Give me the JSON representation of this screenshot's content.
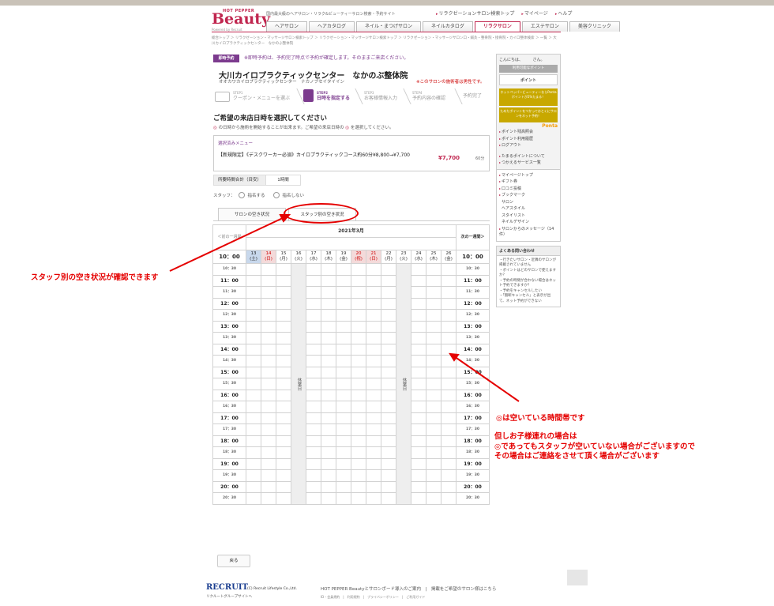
{
  "header": {
    "logo_sub": "HOT PEPPER",
    "logo_main": "Beauty",
    "logo_powered": "Powered by Recruit",
    "tagline": "国内最大級のヘアサロン・リラク&ビューティーサロン検索・予約サイト",
    "top_links": [
      "リラクゼーションサロン検索トップ",
      "マイページ",
      "ヘルプ"
    ],
    "nav": [
      "ヘアサロン",
      "ヘアカタログ",
      "ネイル・まつげサロン",
      "ネイルカタログ",
      "リラクサロン",
      "エステサロン",
      "美容クリニック"
    ],
    "nav_active": 4
  },
  "breadcrumb": "総合トップ ＞ リラクゼーション・マッサージサロン検索トップ ＞ リラクゼーション・マッサージサロン検索トップ ＞ リラクゼーション・マッサージサロン口・鍼灸・整骨院・接骨院・カイロ整体検索 ＞ 一覧 ＞ 大川カイロプラクティックセンター　なかのぶ整体院",
  "notice": {
    "badge": "即時予約",
    "text": "※即時予約は、予約完了時点で予約が確定します。そのままご来店ください。"
  },
  "salon": {
    "name": "大川カイロプラクティックセンター　なかのぶ整体院",
    "kana": "オオカワカイロプラクティックセンター　ナカノブセイタイイン",
    "note": "※このサロンの施術者は男性です。"
  },
  "steps": [
    {
      "num": "STEP1",
      "label": "クーポン・メニューを選ぶ"
    },
    {
      "num": "STEP2",
      "label": "日時を指定する"
    },
    {
      "num": "STEP3",
      "label": "お客様情報入力"
    },
    {
      "num": "STEP4",
      "label": "予約内容の確認"
    },
    {
      "num": "",
      "label": "予約完了"
    }
  ],
  "section_title": "ご希望の来店日時を選択してください",
  "section_sub_a": "の日時から施術を開始することが出来ます。ご希望の来店日時の",
  "section_sub_b": "を選択してください。",
  "section_sub_mark": "◎",
  "menu": {
    "label": "選択済みメニュー",
    "name": "【新規限定】《デスクワーカー必須》カイロプラクティックコース約60分¥8,800→¥7,700",
    "price": "¥7,700",
    "minutes": "60分"
  },
  "duration": {
    "label": "所要時間合計（目安）",
    "value": "1時間"
  },
  "staff": {
    "label": "スタッフ：",
    "opt1": "指名する",
    "opt2": "指名しない"
  },
  "tabs": [
    "サロンの空き状況",
    "スタッフ別の空き状況"
  ],
  "grid": {
    "month": "2021年3月",
    "prev": "＜前の一週間",
    "next": "次の一週間＞",
    "days": [
      {
        "d": "13",
        "w": "(土)",
        "c": "cy"
      },
      {
        "d": "14",
        "w": "(日)",
        "c": "cy sun"
      },
      {
        "d": "15",
        "w": "(月)",
        "c": ""
      },
      {
        "d": "16",
        "w": "(火)",
        "c": ""
      },
      {
        "d": "17",
        "w": "(水)",
        "c": ""
      },
      {
        "d": "18",
        "w": "(木)",
        "c": ""
      },
      {
        "d": "19",
        "w": "(金)",
        "c": ""
      },
      {
        "d": "20",
        "w": "(祝)",
        "c": "sun"
      },
      {
        "d": "21",
        "w": "(日)",
        "c": "sun"
      },
      {
        "d": "22",
        "w": "(月)",
        "c": ""
      },
      {
        "d": "23",
        "w": "(火)",
        "c": ""
      },
      {
        "d": "24",
        "w": "(水)",
        "c": ""
      },
      {
        "d": "25",
        "w": "(木)",
        "c": ""
      },
      {
        "d": "26",
        "w": "(金)",
        "c": ""
      }
    ],
    "time_header": "10：00",
    "closed_text": "休業日",
    "times": [
      "10：30",
      "11：00",
      "11：30",
      "12：00",
      "12：30",
      "13：00",
      "13：30",
      "14：00",
      "14：30",
      "15：00",
      "15：30",
      "16：00",
      "16：30",
      "17：00",
      "17：30",
      "18：00",
      "18：30",
      "19：00",
      "19：30",
      "20：00",
      "20：30"
    ]
  },
  "back_button": "戻る",
  "sidebar": {
    "greeting": "こんにちは、　　　さん。",
    "points_label": "利用可能なポイント",
    "points_val": "ポイント",
    "promo1": "ホットペッパービューティーならPontaポイントが2%たまる！",
    "promo2": "ためたポイントをつかっておとくにサロンをネット予約！",
    "ponta": "Ponta",
    "links1": [
      "ポイント残高照会",
      "ポイント利用履歴",
      "ログアウト"
    ],
    "links2": [
      "たまるポイントについて",
      "つかえるサービス一覧"
    ],
    "links3": [
      "マイページトップ",
      "ギフト券",
      "口コミ投稿",
      "ブックマーク"
    ],
    "links3sub": [
      "サロン",
      "ヘアスタイル",
      "スタイリスト",
      "ネイルデザイン"
    ],
    "links4": [
      "サロンからのメッセージ（14件）"
    ],
    "faq_title": "よくある問い合わせ",
    "faq": [
      "行きたいサロン・近隣のサロンが掲載されていません",
      "ポイントはどのサロンで使えますか？",
      "予約の時間が合わない場合はネット予約できますか？",
      "予約をキャンセルしたい",
      "「無断キャンセル」と表示が出て、ネット予約ができない"
    ]
  },
  "annotations": {
    "a1": "スタッフ別の空き状況が確認できます",
    "a2": "◎は空いている時間帯です",
    "a3": [
      "但しお子様連れの場合は",
      "◎であってもスタッフが空いていない場合がございますので",
      "その場合はご連絡をさせて頂く場合がございます"
    ],
    "arrow_color": "#e50000"
  },
  "footer": {
    "recruit": "RECRUIT",
    "copyright": "(C) Recruit Lifestyle Co.,Ltd.",
    "group": "リクルートグループサイトへ",
    "links": "HOT PEPPER Beautyとサロンボード導入のご案内　|　掲載をご希望のサロン様はこちら",
    "links2": "ID・会員規約　|　利用規約　|　プライバシーポリシー　|　ご利用ガイド"
  },
  "colors": {
    "brand": "#c0264f",
    "accent": "#7c3b8e",
    "annotation": "#e50000"
  }
}
